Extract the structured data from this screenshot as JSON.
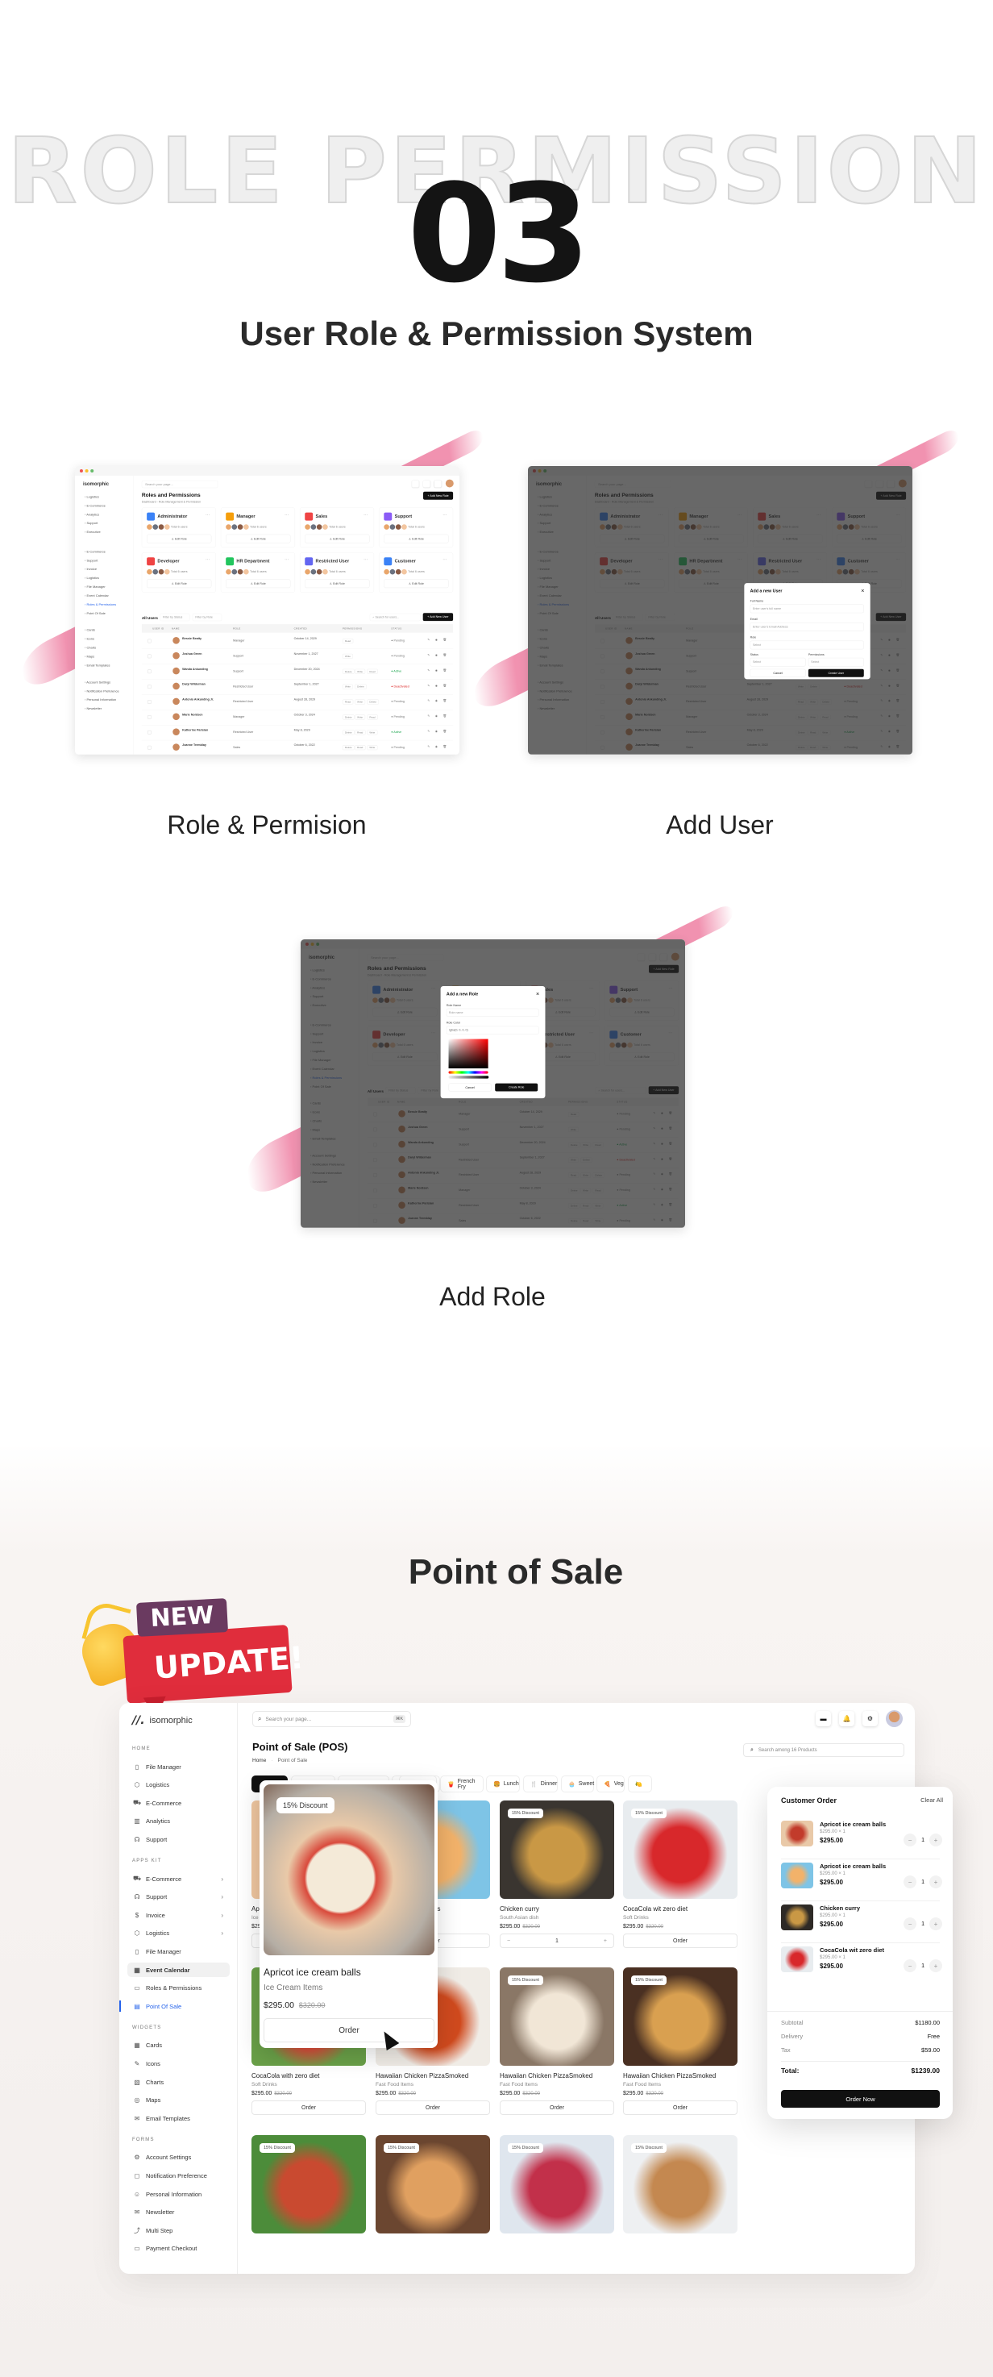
{
  "hero": {
    "watermark": "ROLE PERMISSION",
    "number": "03",
    "title": "User Role & Permission System"
  },
  "screens": [
    {
      "caption": "Role & Permision"
    },
    {
      "caption": "Add User"
    },
    {
      "caption": "Add Role"
    }
  ],
  "dashboard": {
    "brand": "isomorphic",
    "search_placeholder": "Search your page...",
    "search_shortcut": "⌘K",
    "title": "Roles and Permissions",
    "breadcrumb": [
      "Dashboard",
      "Role Management & Permission"
    ],
    "add_role_label": "+ Add New Role",
    "total_users": "Total 6 users",
    "edit_role_label": "Edit Role",
    "roles": [
      {
        "name": "Administrator",
        "color": "#3b82f6"
      },
      {
        "name": "Manager",
        "color": "#f59e0b"
      },
      {
        "name": "Sales",
        "color": "#ef4444"
      },
      {
        "name": "Support",
        "color": "#8b5cf6"
      },
      {
        "name": "Developer",
        "color": "#ef4444"
      },
      {
        "name": "HR Department",
        "color": "#22c55e"
      },
      {
        "name": "Restricted User",
        "color": "#6366f1"
      },
      {
        "name": "Customer",
        "color": "#3b82f6"
      }
    ],
    "all_users_label": "All Users",
    "filter_status": "Filter by Status",
    "filter_role": "Filter by Role",
    "search_users": "Search for users...",
    "add_user_label": "+ Add New User",
    "columns": [
      "USER ID",
      "NAME",
      "ROLE",
      "CREATED",
      "PERMISSIONS",
      "STATUS"
    ],
    "users": [
      {
        "name": "Bessie Beatty",
        "role": "Manager",
        "created": "October 14, 2029",
        "perms": [
          "Read"
        ],
        "status": "Pending"
      },
      {
        "name": "Joshua Green",
        "role": "Support",
        "created": "November 1, 2027",
        "perms": [
          "Write"
        ],
        "status": "Pending"
      },
      {
        "name": "Wanda Ankunding",
        "role": "Support",
        "created": "December 20, 2024",
        "perms": [
          "Delete",
          "Write",
          "Read"
        ],
        "status": "Active"
      },
      {
        "name": "Daryl Wilderman",
        "role": "Restricted User",
        "created": "September 1, 2027",
        "perms": [
          "Write",
          "Delete"
        ],
        "status": "Deactivated"
      },
      {
        "name": "Antonio Ankunding Jr.",
        "role": "Restricted User",
        "created": "August 28, 2029",
        "perms": [
          "Read",
          "Write",
          "Delete"
        ],
        "status": "Pending"
      },
      {
        "name": "Marie Nordsen",
        "role": "Manager",
        "created": "October 3, 2024",
        "perms": [
          "Delete",
          "Write",
          "Read"
        ],
        "status": "Pending"
      },
      {
        "name": "Katherine Parisian",
        "role": "Restricted User",
        "created": "May 8, 2029",
        "perms": [
          "Delete",
          "Read",
          "Write"
        ],
        "status": "Active"
      },
      {
        "name": "Joanne Tremblay",
        "role": "Sales",
        "created": "October 6, 2022",
        "perms": [
          "Delete",
          "Read",
          "Write"
        ],
        "status": "Pending"
      }
    ],
    "status_colors": {
      "Pending": "#777777",
      "Active": "#16a34a",
      "Deactivated": "#dc2626"
    },
    "sidebar": [
      "Logistics",
      "E-Commerce",
      "Analytics",
      "Support",
      "Executive",
      "E-Commerce",
      "Support",
      "Invoice",
      "Logistics",
      "File Manager",
      "Event Calendar",
      "Roles & Permissions",
      "Point Of Sale",
      "Cards",
      "Icons",
      "Charts",
      "Maps",
      "Email Templates",
      "Account Settings",
      "Notification Preference",
      "Personal Information",
      "Newsletter"
    ]
  },
  "add_user_modal": {
    "title": "Add a new User",
    "fields": [
      {
        "label": "Full Name",
        "placeholder": "Enter user's full name"
      },
      {
        "label": "Email",
        "placeholder": "Enter user's Email Address"
      },
      {
        "label": "Role",
        "placeholder": "Select"
      }
    ],
    "status_label": "Status",
    "status_placeholder": "Select",
    "permissions_label": "Permissions",
    "permissions_placeholder": "Select",
    "cancel": "Cancel",
    "submit": "Create User"
  },
  "add_role_modal": {
    "title": "Add a new Role",
    "name_label": "Role Name",
    "name_placeholder": "Role name",
    "color_label": "Role Color",
    "color_value": "rgba(0, 0, 0, 0)",
    "cancel": "Cancel",
    "submit": "Create Role"
  },
  "pos_section": {
    "heading": "Point of Sale",
    "badge_top": "NEW",
    "badge_bottom": "UPDATE!"
  },
  "pos": {
    "brand": "isomorphic",
    "search_placeholder": "Search your page...",
    "search_shortcut": "⌘K",
    "title": "Point of Sale (POS)",
    "breadcrumb": [
      "Home",
      "Point of Sale"
    ],
    "product_search_placeholder": "Search among 16 Products",
    "sidebar": [
      {
        "type": "section",
        "label": "HOME"
      },
      {
        "label": "File Manager",
        "icon": "▯"
      },
      {
        "label": "Logistics",
        "icon": "⬡"
      },
      {
        "label": "E-Commerce",
        "icon": "⛟"
      },
      {
        "label": "Analytics",
        "icon": "▥"
      },
      {
        "label": "Support",
        "icon": "☊"
      },
      {
        "type": "section",
        "label": "APPS KIT"
      },
      {
        "label": "E-Commerce",
        "icon": "⛟",
        "chevron": true
      },
      {
        "label": "Support",
        "icon": "☊",
        "chevron": true
      },
      {
        "label": "Invoice",
        "icon": "$",
        "chevron": true
      },
      {
        "label": "Logistics",
        "icon": "⬡",
        "chevron": true
      },
      {
        "label": "File Manager",
        "icon": "▯"
      },
      {
        "label": "Event Calendar",
        "icon": "▦",
        "state": "active"
      },
      {
        "label": "Roles & Permissions",
        "icon": "▭"
      },
      {
        "label": "Point Of Sale",
        "icon": "▤",
        "state": "current"
      },
      {
        "type": "section",
        "label": "WIDGETS"
      },
      {
        "label": "Cards",
        "icon": "▦"
      },
      {
        "label": "Icons",
        "icon": "✎"
      },
      {
        "label": "Charts",
        "icon": "▧"
      },
      {
        "label": "Maps",
        "icon": "◎"
      },
      {
        "label": "Email Templates",
        "icon": "✉"
      },
      {
        "type": "section",
        "label": "FORMS"
      },
      {
        "label": "Account Settings",
        "icon": "⚙"
      },
      {
        "label": "Notification Preference",
        "icon": "◻"
      },
      {
        "label": "Personal Information",
        "icon": "☺"
      },
      {
        "label": "Newsletter",
        "icon": "✉"
      },
      {
        "label": "Multi Step",
        "icon": "⤴"
      },
      {
        "label": "Payment Checkout",
        "icon": "▭"
      }
    ],
    "categories": [
      {
        "label": "",
        "selected": true
      },
      {
        "label": ""
      },
      {
        "label": ""
      },
      {
        "label": ""
      },
      {
        "label": "Coffee",
        "icon": "☕"
      },
      {
        "label": "French Fry",
        "icon": "🍟"
      },
      {
        "label": "Lunch",
        "icon": "🍔"
      },
      {
        "label": "Dinner",
        "icon": "🍴"
      },
      {
        "label": "Sweet",
        "icon": "🧁"
      },
      {
        "label": "Veg",
        "icon": "🍕"
      },
      {
        "label": "",
        "icon": "🍋"
      }
    ],
    "discount_label": "15% Discount",
    "order_label": "Order",
    "products": [
      {
        "name": "Apricot ice cream balls",
        "category": "Ice Cream Items",
        "price": "$295.00",
        "old_price": "$320.00",
        "img": [
          "#f0c7a0",
          "#9fc9e3"
        ]
      },
      {
        "name": "Apricot ice cream balls",
        "category": "Ice Cream Items",
        "price": "$295.00",
        "old_price": "$320.00",
        "img": [
          "#7ec4e6",
          "#f2b26a"
        ]
      },
      {
        "name": "Chicken curry",
        "category": "South Asian dish",
        "price": "$295.00",
        "old_price": "$320.00",
        "qty": "1",
        "img": [
          "#3a3530",
          "#c99845"
        ]
      },
      {
        "name": "CocaCola wit zero diet",
        "category": "Soft Drinks",
        "price": "$295.00",
        "old_price": "$320.00",
        "img": [
          "#e8ecef",
          "#d8282b"
        ]
      },
      {
        "name": "CocaCola with zero diet",
        "category": "Soft Drinks",
        "price": "$295.00",
        "old_price": "$320.00",
        "img": [
          "#6aa048",
          "#d94d3a"
        ]
      },
      {
        "name": "Hawaiian Chicken PizzaSmoked",
        "category": "Fast Food Items",
        "price": "$295.00",
        "old_price": "$320.00",
        "img": [
          "#f0ece6",
          "#d04a1e"
        ]
      },
      {
        "name": "Hawaiian Chicken PizzaSmoked",
        "category": "Fast Food Items",
        "price": "$295.00",
        "old_price": "$320.00",
        "img": [
          "#8a7766",
          "#f1e6d6"
        ]
      },
      {
        "name": "Hawaiian Chicken PizzaSmoked",
        "category": "Fast Food Items",
        "price": "$295.00",
        "old_price": "$320.00",
        "img": [
          "#4a3022",
          "#d9a050"
        ]
      },
      {
        "name": "",
        "img": [
          "#4c8c3a",
          "#c94a30"
        ]
      },
      {
        "name": "",
        "img": [
          "#6b4630",
          "#e0a060"
        ]
      },
      {
        "name": "",
        "img": [
          "#dfe6ee",
          "#c2304a"
        ]
      },
      {
        "name": "",
        "img": [
          "#eef0f2",
          "#c48850"
        ]
      }
    ],
    "featured": {
      "name": "Apricot ice cream balls",
      "category": "Ice Cream Items",
      "price": "$295.00",
      "old_price": "$320.00",
      "discount": "15% Discount",
      "order": "Order"
    },
    "order_panel": {
      "title": "Customer Order",
      "clear_all": "Clear All",
      "items": [
        {
          "name": "Apricot ice cream balls",
          "unit": "$295.00 × 1",
          "total": "$295.00",
          "qty": "1",
          "img": [
            "#e9c9a8",
            "#c23b2b"
          ]
        },
        {
          "name": "Apricot ice cream balls",
          "unit": "$295.00 × 1",
          "total": "$295.00",
          "qty": "1",
          "img": [
            "#7ec4e6",
            "#f2b26a"
          ]
        },
        {
          "name": "Chicken curry",
          "unit": "$295.00 × 1",
          "total": "$295.00",
          "qty": "1",
          "img": [
            "#2e2a26",
            "#c99845"
          ]
        },
        {
          "name": "CocaCola wit zero diet",
          "unit": "$295.00 × 1",
          "total": "$295.00",
          "qty": "1",
          "img": [
            "#e8ecef",
            "#d8282b"
          ]
        }
      ],
      "subtotal_label": "Subtotal",
      "subtotal": "$1180.00",
      "delivery_label": "Delivery",
      "delivery": "Free",
      "tax_label": "Tax",
      "tax": "$59.00",
      "total_label": "Total:",
      "total": "$1239.00",
      "order_now": "Order Now"
    }
  }
}
